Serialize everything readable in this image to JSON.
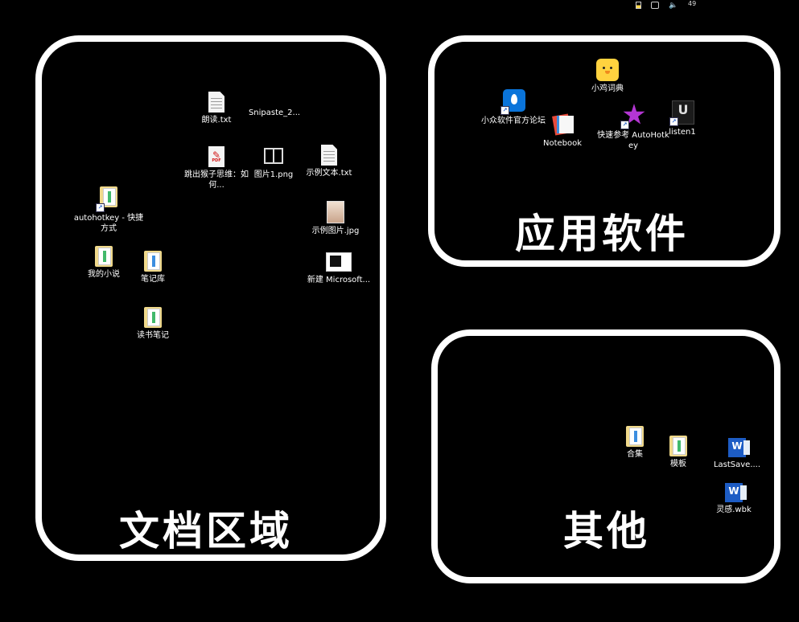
{
  "zones": {
    "docs": {
      "title": "文档区域"
    },
    "apps": {
      "title": "应用软件"
    },
    "other": {
      "title": "其他"
    }
  },
  "tray": {
    "clock": "49",
    "volume_icon": "speaker-icon",
    "message_icon": "notification-icon",
    "battery_icon": "battery-icon"
  },
  "icons": {
    "langdu": {
      "label": "朗读.txt",
      "type": "text-file-icon"
    },
    "snipaste": {
      "label": "Snipaste_2...",
      "type": "image-file-icon"
    },
    "tiaochu": {
      "label": "跳出猴子思维：如何...",
      "type": "pdf-icon"
    },
    "tupian1": {
      "label": "图片1.png",
      "type": "png-icon"
    },
    "shili_txt": {
      "label": "示例文本.txt",
      "type": "text-file-icon"
    },
    "autohotkey_sc": {
      "label": "autohotkey - 快捷方式",
      "type": "folder-shortcut-icon"
    },
    "shili_jpg": {
      "label": "示例图片.jpg",
      "type": "jpg-icon"
    },
    "wodexiaoshuo": {
      "label": "我的小说",
      "type": "folder-icon"
    },
    "bijiku": {
      "label": "笔记库",
      "type": "folder-icon"
    },
    "xinjian": {
      "label": "新建 Microsoft...",
      "type": "new-doc-icon"
    },
    "dushubiji": {
      "label": "读书笔记",
      "type": "folder-icon"
    },
    "xiaojicidian": {
      "label": "小鸡词典",
      "type": "chick-icon"
    },
    "xiaozhong": {
      "label": "小众软件官方论坛",
      "type": "drop-icon"
    },
    "notebook": {
      "label": "Notebook",
      "type": "notebook-icon"
    },
    "kuaisu": {
      "label": "快速参考 AutoHotkey",
      "type": "star-icon"
    },
    "listen1": {
      "label": "listen1",
      "type": "listen-icon"
    },
    "heji": {
      "label": "合集",
      "type": "folder-icon"
    },
    "muban": {
      "label": "模板",
      "type": "folder-icon"
    },
    "lastsave": {
      "label": "LastSave....",
      "type": "word-icon"
    },
    "linggan": {
      "label": "灵感.wbk",
      "type": "word-icon"
    }
  }
}
